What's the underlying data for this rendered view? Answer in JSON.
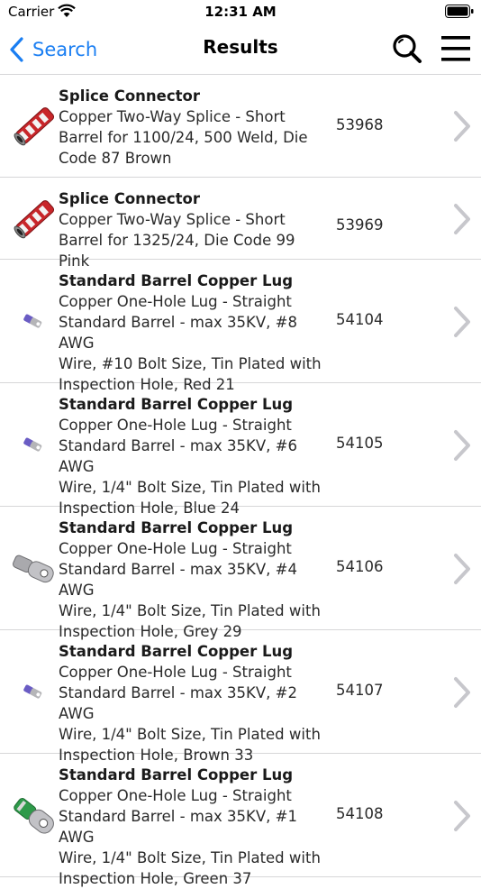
{
  "status": {
    "carrier": "Carrier",
    "time": "12:31 AM"
  },
  "nav": {
    "back_label": "Search",
    "title": "Results",
    "accent": "#1a7ef2"
  },
  "results": [
    {
      "name": "Splice Connector",
      "desc": [
        "Copper Two-Way Splice - Short",
        "Barrel for 1100/24, 500 Weld, Die",
        "Code 87 Brown"
      ],
      "number": "53968",
      "icon": "splice-connector-red"
    },
    {
      "name": "Splice Connector",
      "desc": [
        "Copper Two-Way Splice - Short",
        "Barrel for 1325/24, Die Code 99 Pink"
      ],
      "number": "53969",
      "icon": "splice-connector-red"
    },
    {
      "name": "Standard Barrel Copper Lug",
      "desc": [
        "Copper One-Hole Lug - Straight",
        "Standard Barrel - max 35KV, #8 AWG",
        "Wire, #10 Bolt Size, Tin Plated with",
        "Inspection Hole,  Red 21"
      ],
      "number": "54104",
      "icon": "lug-purple-small"
    },
    {
      "name": "Standard Barrel Copper Lug",
      "desc": [
        "Copper One-Hole Lug - Straight",
        "Standard Barrel - max 35KV, #6 AWG",
        "Wire, 1/4\" Bolt Size, Tin Plated with",
        "Inspection Hole,  Blue 24"
      ],
      "number": "54105",
      "icon": "lug-purple-small"
    },
    {
      "name": "Standard Barrel Copper Lug",
      "desc": [
        "Copper One-Hole Lug - Straight",
        "Standard Barrel - max 35KV, #4 AWG",
        "Wire, 1/4\" Bolt Size, Tin Plated with",
        "Inspection Hole,  Grey 29"
      ],
      "number": "54106",
      "icon": "lug-grey-large"
    },
    {
      "name": "Standard Barrel Copper Lug",
      "desc": [
        "Copper One-Hole Lug - Straight",
        "Standard Barrel - max 35KV, #2 AWG",
        "Wire, 1/4\" Bolt Size, Tin Plated with",
        "Inspection Hole,  Brown 33"
      ],
      "number": "54107",
      "icon": "lug-purple-small"
    },
    {
      "name": "Standard Barrel Copper Lug",
      "desc": [
        "Copper One-Hole Lug - Straight",
        "Standard Barrel - max 35KV, #1 AWG",
        "Wire, 1/4\" Bolt Size, Tin Plated with",
        "Inspection Hole,  Green 37"
      ],
      "number": "54108",
      "icon": "lug-green-large"
    }
  ]
}
